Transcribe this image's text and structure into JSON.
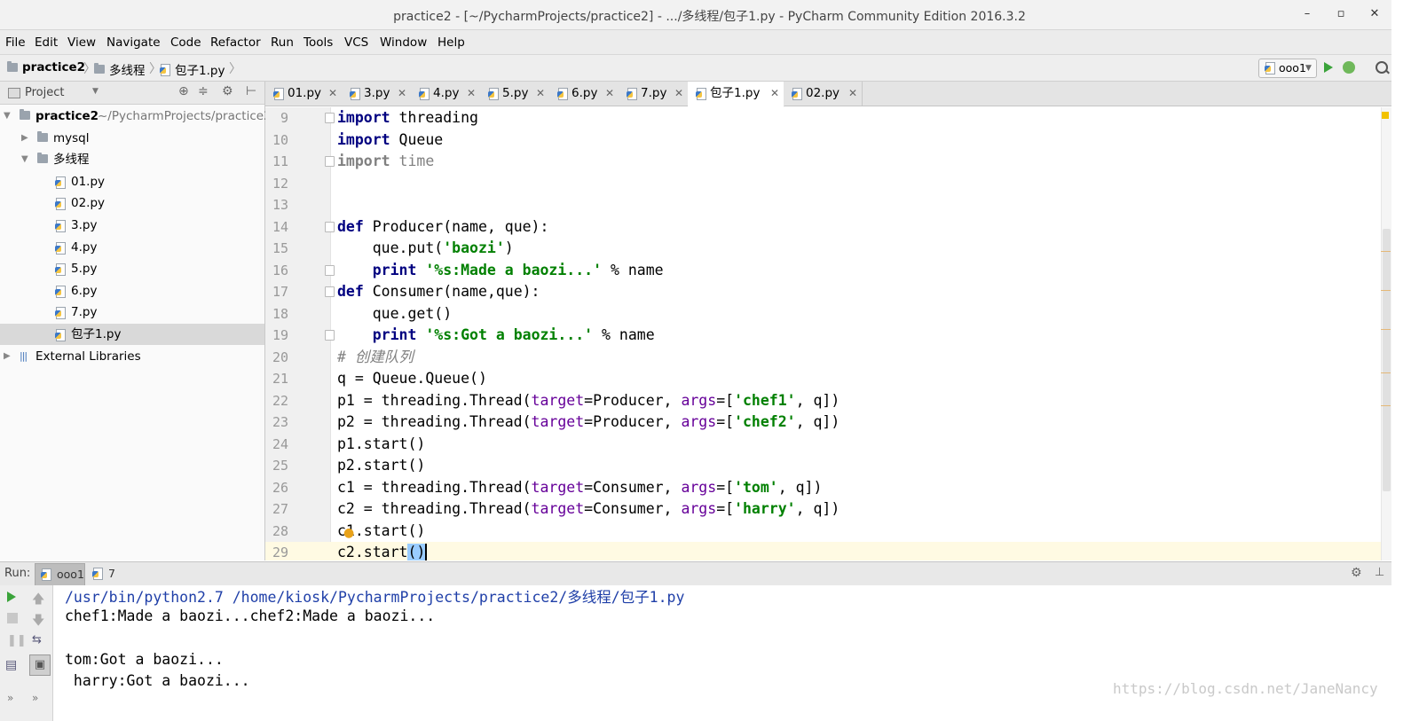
{
  "window": {
    "title": "practice2 - [~/PycharmProjects/practice2] - .../多线程/包子1.py - PyCharm Community Edition 2016.3.2",
    "minimize": "–",
    "maximize": "▫",
    "close": "✕"
  },
  "menu": [
    "File",
    "Edit",
    "View",
    "Navigate",
    "Code",
    "Refactor",
    "Run",
    "Tools",
    "VCS",
    "Window",
    "Help"
  ],
  "breadcrumb": [
    "practice2",
    "多线程",
    "包子1.py"
  ],
  "run_config": "ooo1",
  "project_panel": {
    "label": "Project",
    "tree": [
      {
        "label": "practice2",
        "path": "~/PycharmProjects/practice2",
        "indent": 0,
        "arrow": "▼",
        "icon": "folder",
        "bold": true
      },
      {
        "label": "mysql",
        "indent": 1,
        "arrow": "▶",
        "icon": "folder"
      },
      {
        "label": "多线程",
        "indent": 1,
        "arrow": "▼",
        "icon": "folder"
      },
      {
        "label": "01.py",
        "indent": 2,
        "icon": "py"
      },
      {
        "label": "02.py",
        "indent": 2,
        "icon": "py"
      },
      {
        "label": "3.py",
        "indent": 2,
        "icon": "py"
      },
      {
        "label": "4.py",
        "indent": 2,
        "icon": "py"
      },
      {
        "label": "5.py",
        "indent": 2,
        "icon": "py"
      },
      {
        "label": "6.py",
        "indent": 2,
        "icon": "py"
      },
      {
        "label": "7.py",
        "indent": 2,
        "icon": "py"
      },
      {
        "label": "包子1.py",
        "indent": 2,
        "icon": "py",
        "selected": true
      },
      {
        "label": "External Libraries",
        "indent": 0,
        "arrow": "▶",
        "icon": "lib"
      }
    ]
  },
  "tabs": [
    {
      "label": "01.py"
    },
    {
      "label": "3.py"
    },
    {
      "label": "4.py"
    },
    {
      "label": "5.py"
    },
    {
      "label": "6.py"
    },
    {
      "label": "7.py"
    },
    {
      "label": "包子1.py",
      "active": true
    },
    {
      "label": "02.py"
    }
  ],
  "code": [
    {
      "n": "9",
      "tokens": [
        [
          "kw",
          "import"
        ],
        [
          "",
          " threading"
        ]
      ],
      "fold": true
    },
    {
      "n": "10",
      "tokens": [
        [
          "kw",
          "import"
        ],
        [
          "",
          " Queue"
        ]
      ]
    },
    {
      "n": "11",
      "tokens": [
        [
          "kw-dim",
          "import"
        ],
        [
          "unused",
          " time"
        ]
      ],
      "fold": true
    },
    {
      "n": "12",
      "tokens": []
    },
    {
      "n": "13",
      "tokens": []
    },
    {
      "n": "14",
      "tokens": [
        [
          "kw",
          "def"
        ],
        [
          "",
          " Producer(name, que):"
        ]
      ],
      "fold": true
    },
    {
      "n": "15",
      "tokens": [
        [
          "",
          "    que.put("
        ],
        [
          "str",
          "'baozi'"
        ],
        [
          "",
          ")"
        ]
      ]
    },
    {
      "n": "16",
      "tokens": [
        [
          "",
          "    "
        ],
        [
          "kw",
          "print"
        ],
        [
          "",
          " "
        ],
        [
          "str",
          "'%s:Made a baozi...'"
        ],
        [
          "",
          " % name"
        ]
      ],
      "fold": true
    },
    {
      "n": "17",
      "tokens": [
        [
          "kw",
          "def"
        ],
        [
          "",
          " Consumer(name,que):"
        ]
      ],
      "fold": true
    },
    {
      "n": "18",
      "tokens": [
        [
          "",
          "    que.get()"
        ]
      ]
    },
    {
      "n": "19",
      "tokens": [
        [
          "",
          "    "
        ],
        [
          "kw",
          "print"
        ],
        [
          "",
          " "
        ],
        [
          "str",
          "'%s:Got a baozi...'"
        ],
        [
          "",
          " % name"
        ]
      ],
      "fold": true
    },
    {
      "n": "20",
      "tokens": [
        [
          "cmt",
          "# 创建队列"
        ]
      ]
    },
    {
      "n": "21",
      "tokens": [
        [
          "",
          "q = Queue.Queue()"
        ]
      ]
    },
    {
      "n": "22",
      "tokens": [
        [
          "",
          "p1 = threading.Thread("
        ],
        [
          "param",
          "target"
        ],
        [
          "",
          "=Producer, "
        ],
        [
          "param",
          "args"
        ],
        [
          "",
          "=["
        ],
        [
          "str",
          "'chef1'"
        ],
        [
          "",
          ", q])"
        ]
      ]
    },
    {
      "n": "23",
      "tokens": [
        [
          "",
          "p2 = threading.Thread("
        ],
        [
          "param",
          "target"
        ],
        [
          "",
          "=Producer, "
        ],
        [
          "param",
          "args"
        ],
        [
          "",
          "=["
        ],
        [
          "str",
          "'chef2'"
        ],
        [
          "",
          ", q])"
        ]
      ]
    },
    {
      "n": "24",
      "tokens": [
        [
          "",
          "p1.start()"
        ]
      ]
    },
    {
      "n": "25",
      "tokens": [
        [
          "",
          "p2.start()"
        ]
      ]
    },
    {
      "n": "26",
      "tokens": [
        [
          "",
          "c1 = threading.Thread("
        ],
        [
          "param",
          "target"
        ],
        [
          "",
          "=Consumer, "
        ],
        [
          "param",
          "args"
        ],
        [
          "",
          "=["
        ],
        [
          "str",
          "'tom'"
        ],
        [
          "",
          ", q])"
        ]
      ]
    },
    {
      "n": "27",
      "tokens": [
        [
          "",
          "c2 = threading.Thread("
        ],
        [
          "param",
          "target"
        ],
        [
          "",
          "=Consumer, "
        ],
        [
          "param",
          "args"
        ],
        [
          "",
          "=["
        ],
        [
          "str",
          "'harry'"
        ],
        [
          "",
          ", q])"
        ]
      ]
    },
    {
      "n": "28",
      "tokens": [
        [
          "",
          "c1.start()"
        ]
      ]
    },
    {
      "n": "29",
      "tokens": [
        [
          "",
          "c2.start"
        ],
        [
          "brace-hl",
          "()"
        ],
        [
          "caret",
          ""
        ]
      ],
      "current": true
    }
  ],
  "run_panel": {
    "label": "Run:",
    "tabs": [
      {
        "label": "ooo1",
        "active": true
      },
      {
        "label": "7"
      }
    ],
    "console": [
      {
        "text": "/usr/bin/python2.7 /home/kiosk/PycharmProjects/practice2/多线程/包子1.py",
        "cls": "console-path"
      },
      {
        "text": "chef1:Made a baozi...chef2:Made a baozi...",
        "cls": ""
      },
      {
        "text": "",
        "cls": ""
      },
      {
        "text": "tom:Got a baozi...",
        "cls": ""
      },
      {
        "text": " harry:Got a baozi...",
        "cls": ""
      }
    ]
  },
  "watermark": "https://blog.csdn.net/JaneNancy",
  "colors": {
    "keyword": "#000080",
    "string": "#008000",
    "param": "#660099",
    "comment": "#808080",
    "run_green": "#3aa33a"
  }
}
